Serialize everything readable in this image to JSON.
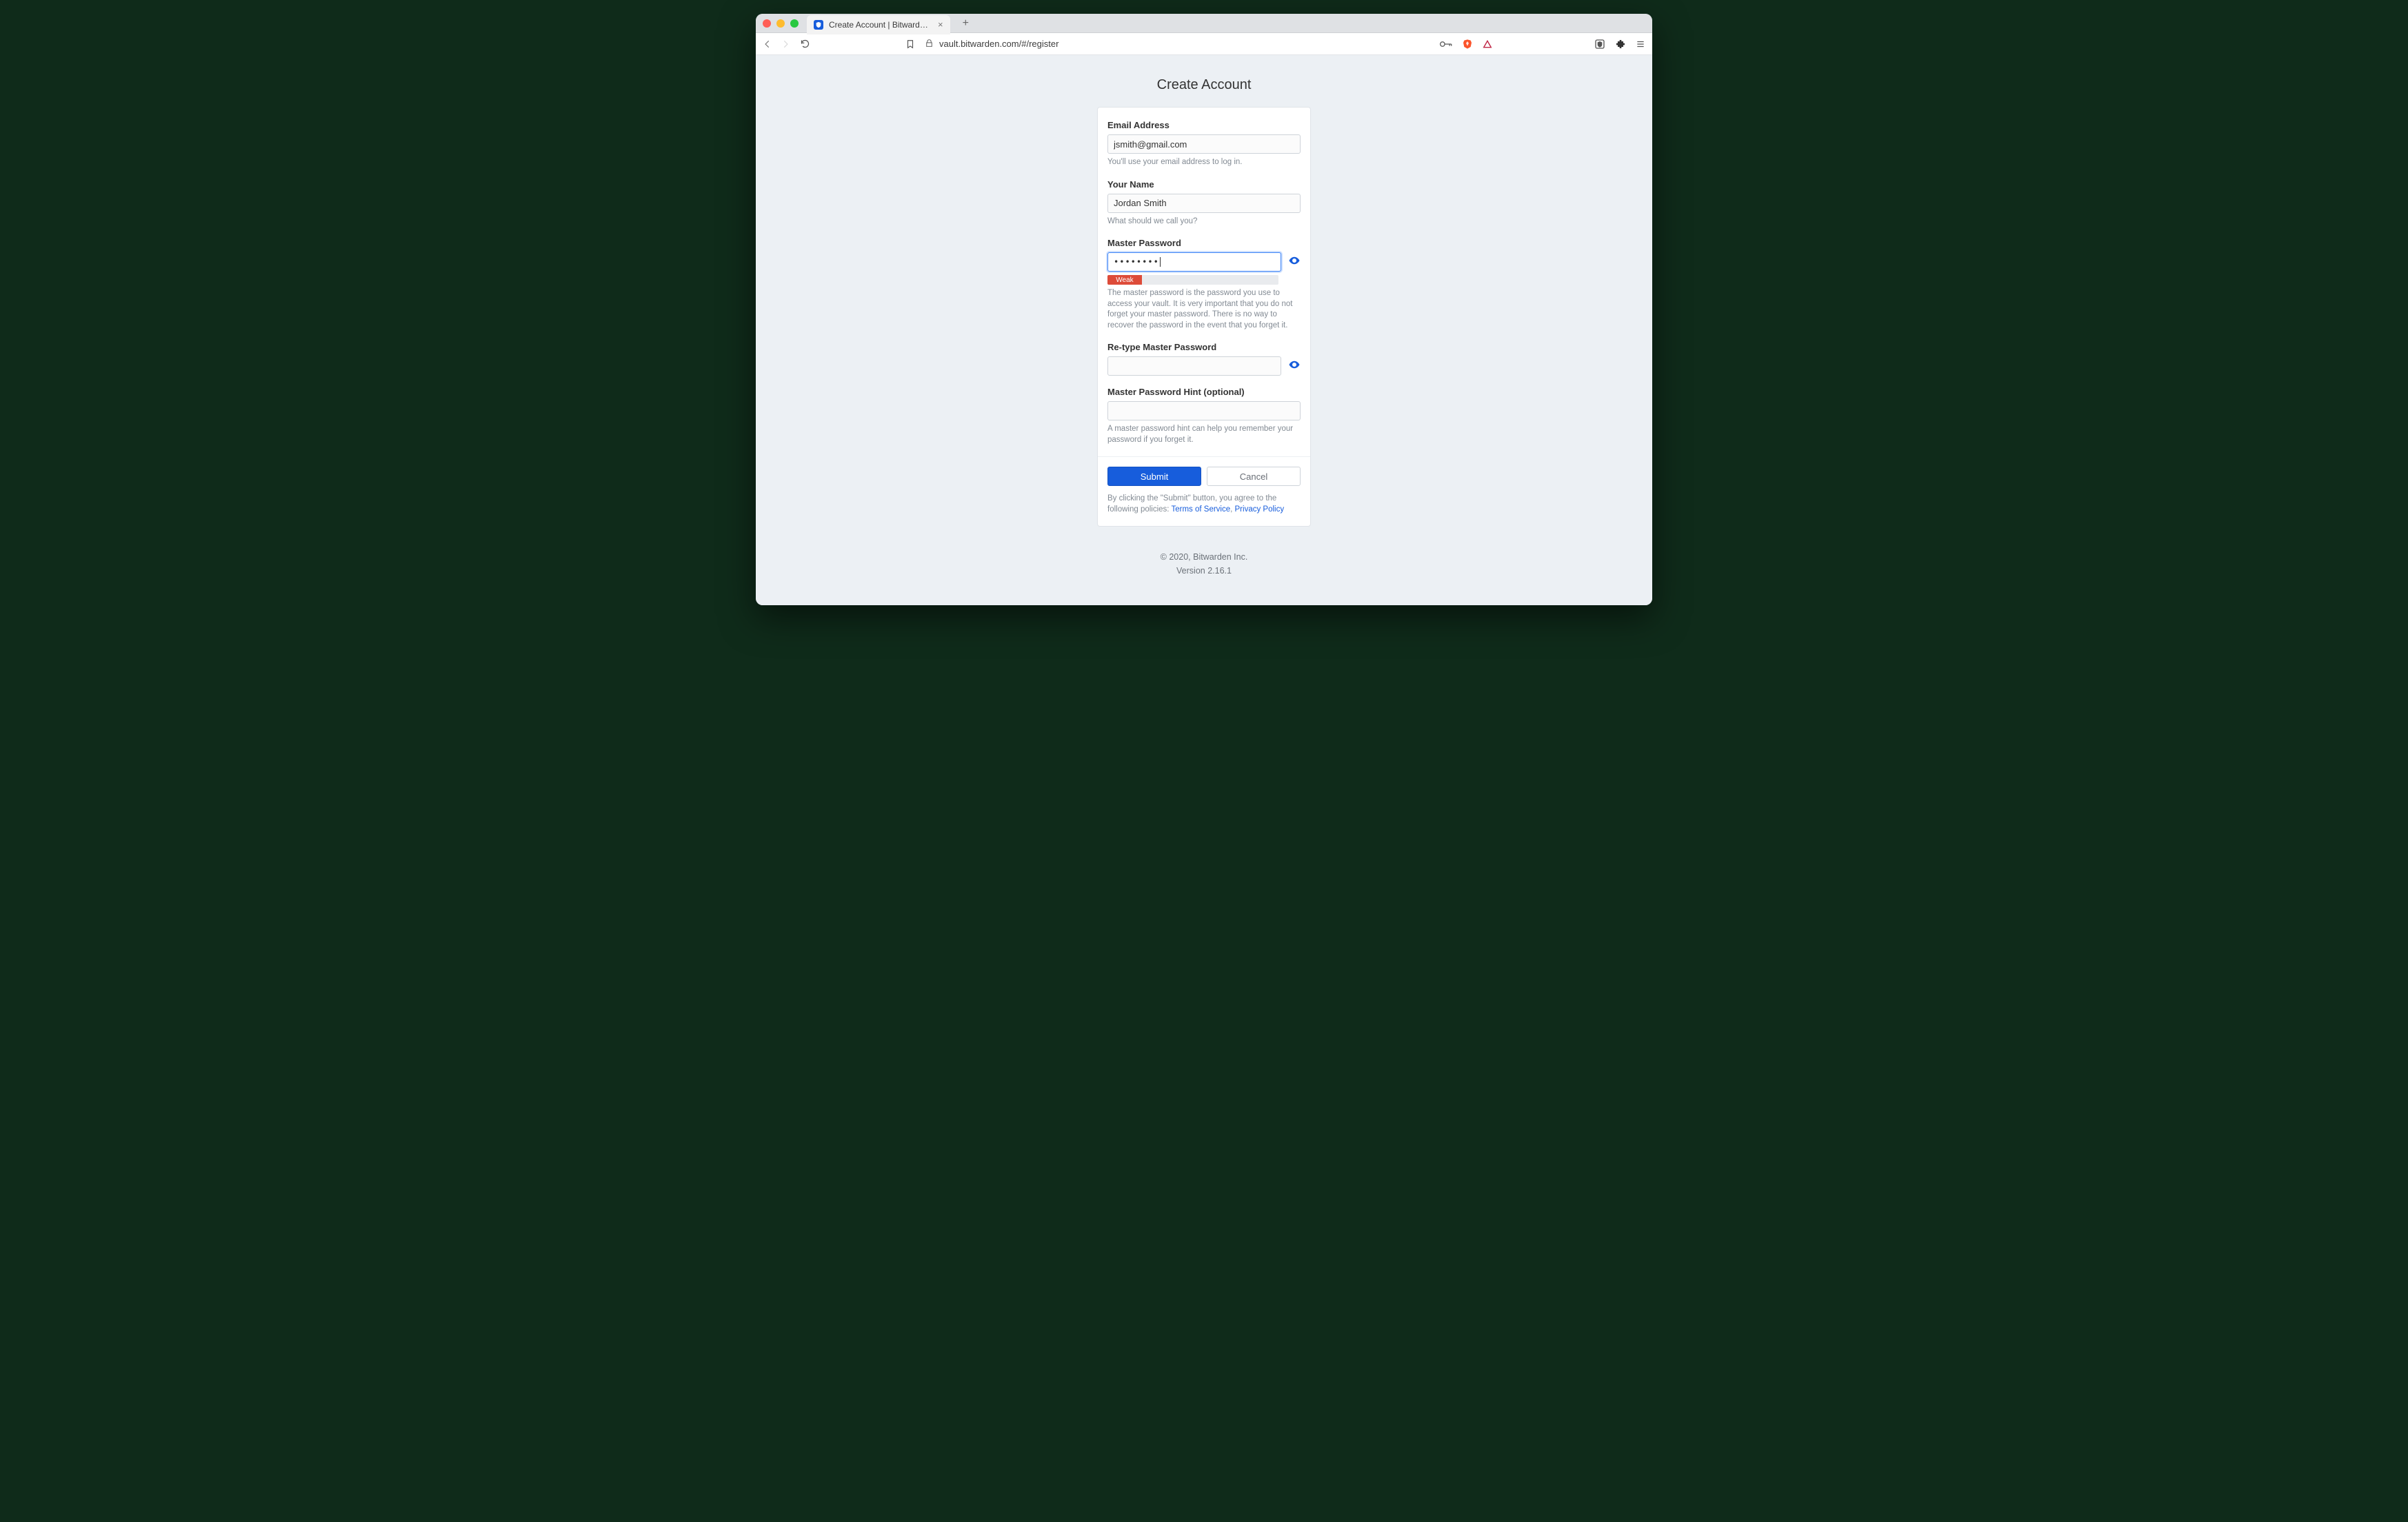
{
  "browser": {
    "tab_title": "Create Account | Bitwarden Web",
    "url": "vault.bitwarden.com/#/register"
  },
  "page": {
    "title": "Create Account"
  },
  "form": {
    "email": {
      "label": "Email Address",
      "value": "jsmith@gmail.com",
      "hint": "You'll use your email address to log in."
    },
    "name": {
      "label": "Your Name",
      "value": "Jordan Smith",
      "hint": "What should we call you?"
    },
    "password": {
      "label": "Master Password",
      "value_masked": "••••••••",
      "strength_label": "Weak",
      "hint": "The master password is the password you use to access your vault. It is very important that you do not forget your master password. There is no way to recover the password in the event that you forget it."
    },
    "password_confirm": {
      "label": "Re-type Master Password",
      "value": ""
    },
    "hint_field": {
      "label": "Master Password Hint (optional)",
      "value": "",
      "hint": "A master password hint can help you remember your password if you forget it."
    },
    "buttons": {
      "submit": "Submit",
      "cancel": "Cancel"
    },
    "agree": {
      "prefix": "By clicking the \"Submit\" button, you agree to the following policies: ",
      "tos": "Terms of Service",
      "sep": ", ",
      "privacy": "Privacy Policy"
    }
  },
  "footer": {
    "copyright": "© 2020, Bitwarden Inc.",
    "version": "Version 2.16.1"
  }
}
